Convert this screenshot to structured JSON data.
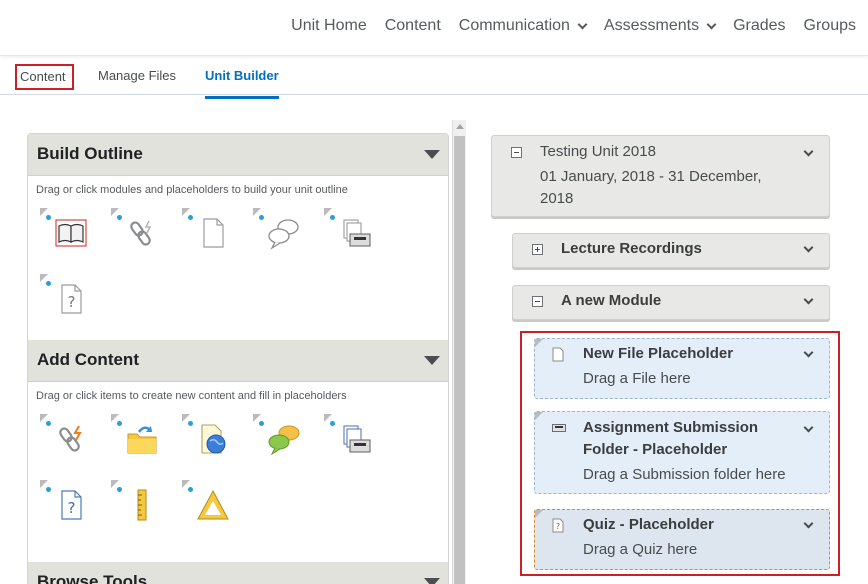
{
  "topnav": {
    "items": [
      {
        "label": "Unit Home",
        "dropdown": false
      },
      {
        "label": "Content",
        "dropdown": false
      },
      {
        "label": "Communication",
        "dropdown": true
      },
      {
        "label": "Assessments",
        "dropdown": true
      },
      {
        "label": "Grades",
        "dropdown": false
      },
      {
        "label": "Groups",
        "dropdown": false
      }
    ]
  },
  "subtabs": {
    "content": "Content",
    "manage_files": "Manage Files",
    "unit_builder": "Unit Builder",
    "active": "Unit Builder"
  },
  "left_panel": {
    "build_outline": {
      "title": "Build Outline",
      "description": "Drag or click modules and placeholders to build your unit outline",
      "icons": [
        "module-book-icon",
        "link-placeholder-icon",
        "file-placeholder-icon",
        "discussion-placeholder-icon",
        "submission-folder-placeholder-icon",
        "quiz-placeholder-icon"
      ]
    },
    "add_content": {
      "title": "Add Content",
      "description": "Drag or click items to create new content and fill in placeholders",
      "icons": [
        "new-link-icon",
        "upload-folder-icon",
        "new-web-page-icon",
        "new-discussion-icon",
        "new-submission-folder-icon",
        "new-quiz-icon",
        "ruler-icon",
        "triangle-icon"
      ]
    },
    "browse_tools": {
      "title": "Browse Tools"
    }
  },
  "tree": {
    "root": {
      "title": "Testing Unit 2018",
      "dates_line1": "01 January, 2018 - 31 December,",
      "dates_line2": "2018"
    },
    "modules": [
      {
        "title": "Lecture Recordings",
        "expanded": false
      },
      {
        "title": "A new Module",
        "expanded": true
      }
    ],
    "placeholders": [
      {
        "title_line1": "New File Placeholder",
        "title_line2": "",
        "hint": "Drag a File here",
        "icon": "file-icon"
      },
      {
        "title_line1": "Assignment Submission",
        "title_line2": "Folder - Placeholder",
        "hint": "Drag a Submission folder here",
        "icon": "submission-folder-icon"
      },
      {
        "title_line1": "Quiz - Placeholder",
        "title_line2": "",
        "hint": "Drag a Quiz here",
        "icon": "quiz-icon"
      }
    ]
  },
  "colors": {
    "accent": "#006fbf",
    "highlight_red": "#cd2026",
    "section_header": "#e1e2dc",
    "placeholder_bg": "#e4eef8",
    "quiz_border": "#e08a2a"
  }
}
